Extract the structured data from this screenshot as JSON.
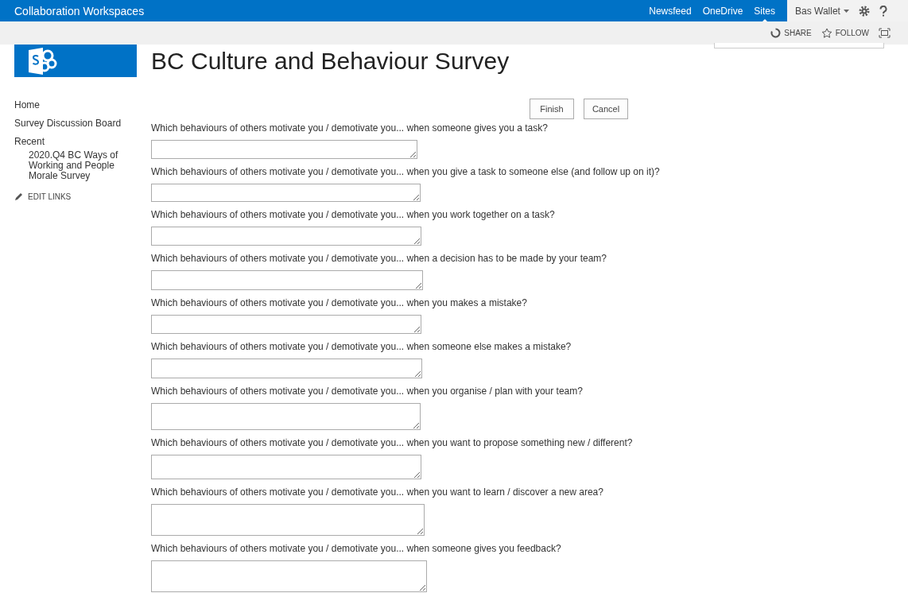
{
  "suite_bar": {
    "title": "Collaboration Workspaces",
    "links": [
      {
        "label": "Newsfeed",
        "selected": false
      },
      {
        "label": "OneDrive",
        "selected": false
      },
      {
        "label": "Sites",
        "selected": true
      }
    ],
    "user": "Bas Wallet"
  },
  "ribbon": {
    "actions": [
      {
        "kind": "share",
        "label": "SHARE"
      },
      {
        "kind": "follow",
        "label": "FOLLOW"
      },
      {
        "kind": "focus"
      }
    ]
  },
  "page_title": "BC Culture and Behaviour Survey",
  "sidebar": {
    "items": [
      {
        "label": "Home"
      },
      {
        "label": "Survey Discussion Board"
      },
      {
        "label": "Recent",
        "children": [
          {
            "label": "2020.Q4 BC Ways of Working and People Morale Survey"
          }
        ]
      }
    ],
    "edit_links": "EDIT LINKS"
  },
  "buttons": [
    "Finish",
    "Cancel"
  ],
  "questions": [
    {
      "label": "Which behaviours of others motivate you / demotivate you... when someone gives you a task?"
    },
    {
      "label": "Which behaviours of others motivate you / demotivate you... when you give a task to someone else (and follow up on it)?"
    },
    {
      "label": "Which behaviours of others motivate you / demotivate you... when you work together on a task?"
    },
    {
      "label": "Which behaviours of others motivate you / demotivate you... when a decision has to be made by your team?"
    },
    {
      "label": "Which behaviours of others motivate you / demotivate you... when you makes a mistake?"
    },
    {
      "label": "Which behaviours of others motivate you / demotivate you... when someone else makes a mistake?"
    },
    {
      "label": "Which behaviours of others motivate you / demotivate you... when you organise / plan with your team?"
    },
    {
      "label": "Which behaviours of others motivate you / demotivate you... when you want to propose something new / different?"
    },
    {
      "label": "Which behaviours of others motivate you / demotivate you... when you want to learn / discover a new area?"
    },
    {
      "label": "Which behaviours of others motivate you / demotivate you... when someone gives you feedback?"
    }
  ]
}
